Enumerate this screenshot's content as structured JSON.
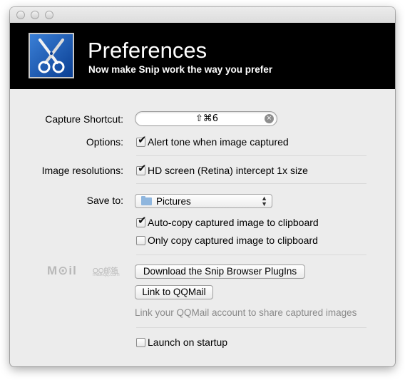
{
  "window": {
    "controls": [
      "close",
      "minimize",
      "zoom"
    ]
  },
  "banner": {
    "title": "Preferences",
    "subtitle": "Now make Snip work the way you prefer",
    "icon": "scissors-icon"
  },
  "capture_shortcut": {
    "label": "Capture Shortcut:",
    "value": "⇧⌘6"
  },
  "options": {
    "label": "Options:",
    "alert_tone": {
      "label": "Alert tone when image captured",
      "checked": true
    }
  },
  "image_resolutions": {
    "label": "Image resolutions:",
    "hd_screen": {
      "label": "HD screen (Retina) intercept 1x size",
      "checked": true
    }
  },
  "save_to": {
    "label": "Save to:",
    "selected": "Pictures",
    "auto_copy": {
      "label": "Auto-copy captured image to clipboard",
      "checked": true
    },
    "only_copy": {
      "label": "Only copy captured image to clipboard",
      "checked": false
    }
  },
  "qqmail": {
    "logo_main": "M⊙il",
    "logo_cn": "QQ邮箱",
    "logo_url": "mail.qq.com",
    "download_button": "Download the Snip Browser PlugIns",
    "link_button": "Link to QQMail",
    "hint": "Link your QQMail account to share captured images"
  },
  "launch": {
    "label": "Launch on startup",
    "checked": false
  }
}
